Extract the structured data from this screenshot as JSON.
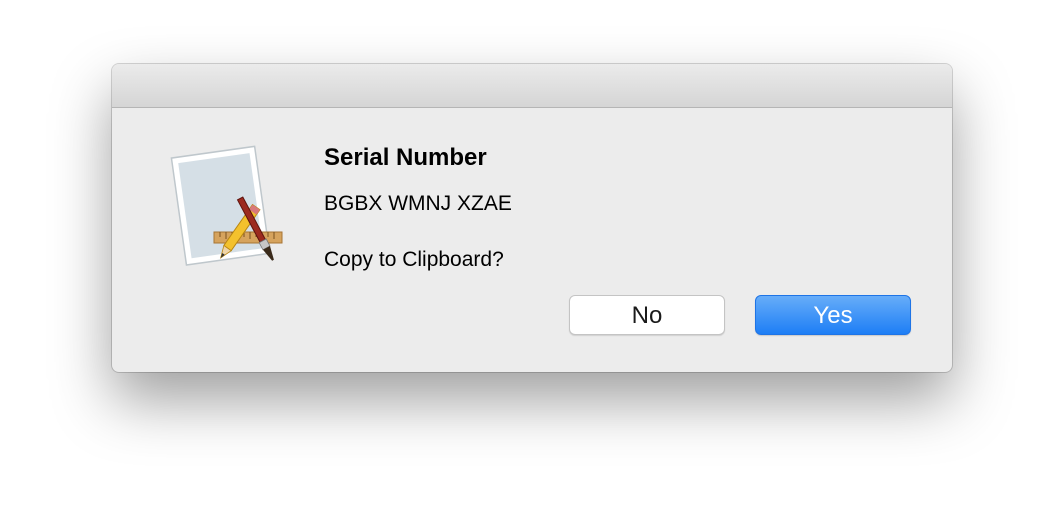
{
  "dialog": {
    "title": "Serial Number",
    "serial": "BGBX WMNJ XZAE",
    "question": "Copy to Clipboard?",
    "icon": "app-developer-icon",
    "buttons": {
      "no_label": "No",
      "yes_label": "Yes"
    },
    "colors": {
      "accent": "#1d7ef5",
      "background": "#ececec"
    }
  }
}
